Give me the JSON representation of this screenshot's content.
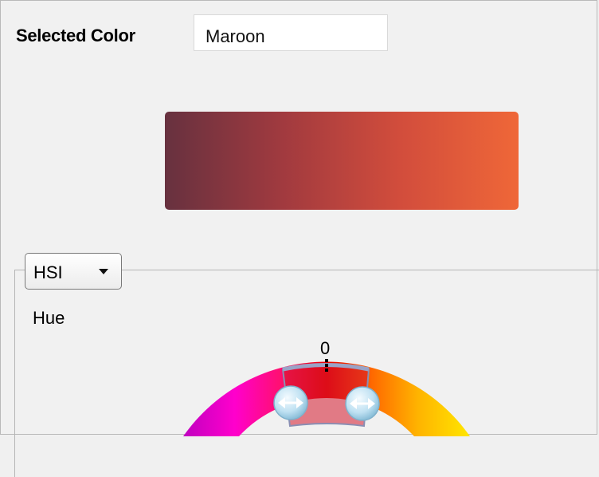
{
  "selected_color": {
    "label": "Selected Color",
    "value": "Maroon"
  },
  "swatch": {
    "gradient_colors": [
      "#67313f",
      "#a13a3f",
      "#d24d3c",
      "#ef6738"
    ]
  },
  "color_model": {
    "selected": "HSI"
  },
  "hue": {
    "label": "Hue",
    "zero_label": "0"
  },
  "icons": [
    "chevron-down-icon",
    "double-arrow-icon"
  ]
}
